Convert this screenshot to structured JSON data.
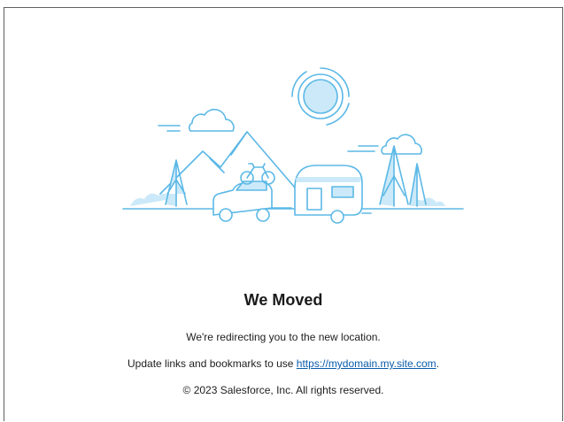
{
  "icon": "camping-road-trip-illustration",
  "colors": {
    "illustration_stroke": "#5bb8e6",
    "illustration_fill": "#cbe9f8",
    "link": "#0b5cab",
    "title": "#1a1a1a"
  },
  "page": {
    "title": "We Moved",
    "redirect_text": "We're redirecting you to the new location.",
    "update_text": "Update links and bookmarks to use ",
    "link_text": "https://mydomain.my.site.com",
    "update_suffix": ".",
    "copyright": "© 2023 Salesforce, Inc. All rights reserved."
  }
}
